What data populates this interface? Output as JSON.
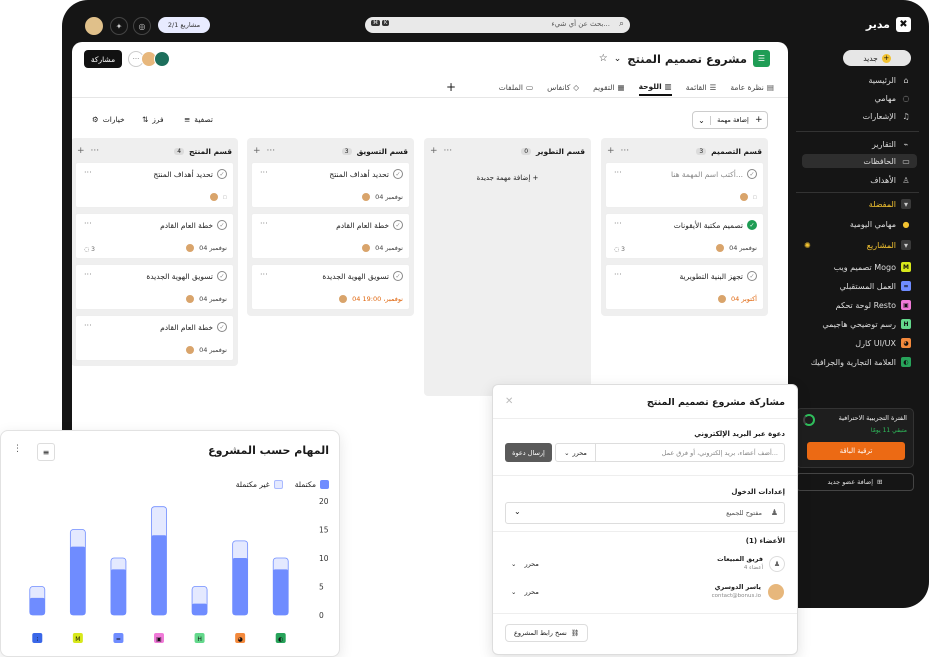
{
  "topbar": {
    "search_placeholder": "بحث عن أي شيء...",
    "kbd1": "⌘",
    "kbd2": "K",
    "projects_badge": "2/1 مشاريع"
  },
  "sidebar": {
    "app_name": "مدير",
    "new_label": "جديد",
    "nav": [
      {
        "label": "الرئيسية"
      },
      {
        "label": "مهامي"
      },
      {
        "label": "الإشعارات"
      }
    ],
    "nav2": [
      {
        "label": "التقارير"
      },
      {
        "label": "الحافظات"
      },
      {
        "label": "الأهداف"
      }
    ],
    "favorites_label": "المفضلة",
    "daily_tasks": "مهامي اليومية",
    "projects_label": "المشاريع",
    "projects": [
      {
        "label": "تصميم ويب Mogo",
        "letter": "M",
        "color": "#d7e81b"
      },
      {
        "label": "العمل المستقبلي",
        "letter": "=",
        "color": "#6f8cff"
      },
      {
        "label": "لوحة تحكم Resto",
        "letter": "▣",
        "color": "#f07ad8"
      },
      {
        "label": "رسم توضيحي هاجيمي",
        "letter": "H",
        "color": "#63d88b"
      },
      {
        "label": "كارل UI/UX",
        "letter": "◕",
        "color": "#f3893c"
      },
      {
        "label": "العلامة التجارية والجرافيك",
        "letter": "◐",
        "color": "#27a35a"
      }
    ],
    "trial_title": "الفترة التجريبية الاحترافية",
    "trial_remaining": "متبقي 11 يومًا",
    "upgrade_label": "ترقية الباقة",
    "add_member_label": "إضافة عضو جديد"
  },
  "header": {
    "project_title": "مشروع تصميم المنتج",
    "share_label": "مشاركة"
  },
  "tabs": [
    {
      "label": "نظرة عامة"
    },
    {
      "label": "القائمة"
    },
    {
      "label": "اللوحة"
    },
    {
      "label": "التقويم"
    },
    {
      "label": "كانفاس"
    },
    {
      "label": "الملفات"
    }
  ],
  "toolbar": {
    "add_task_label": "إضافة مهمة",
    "filter_label": "تصفية",
    "sort_label": "فرز",
    "options_label": "خيارات"
  },
  "columns": [
    {
      "title": "قسم التصميم",
      "count": "3",
      "cards": [
        {
          "title": "أكتب اسم المهمة هنا...",
          "date": "",
          "comments": ""
        },
        {
          "title": "تصميم مكتبة الأيقونات",
          "date": "04 نوفمبر",
          "comments": "3"
        },
        {
          "title": "تجهز البنية التطويرية",
          "date": "04 أكتوبر",
          "comments": ""
        }
      ]
    },
    {
      "title": "قسم التطوير",
      "count": "0",
      "add_label": "إضافة مهمة جديدة"
    },
    {
      "title": "قسم التسويق",
      "count": "3",
      "cards": [
        {
          "title": "تحديد أهداف المنتج",
          "date": "04 نوفمبر",
          "comments": ""
        },
        {
          "title": "خطة العام القادم",
          "date": "04 نوفمبر",
          "comments": ""
        },
        {
          "title": "تسويق الهوية الجديدة",
          "date": "04 نوفمبر، 19:00",
          "comments": ""
        }
      ]
    },
    {
      "title": "قسم المنتج",
      "count": "4",
      "cards": [
        {
          "title": "تحديد أهداف المنتج",
          "date": "",
          "comments": ""
        },
        {
          "title": "خطة العام القادم",
          "date": "04 نوفمبر",
          "comments": "3"
        },
        {
          "title": "تسويق الهوية الجديدة",
          "date": "04 نوفمبر",
          "comments": ""
        },
        {
          "title": "خطة العام القادم",
          "date": "04 نوفمبر",
          "comments": ""
        }
      ]
    }
  ],
  "share_panel": {
    "title": "مشاركة مشروع تصميم المنتج",
    "invite_label": "دعوة عبر البريد الإلكتروني",
    "invite_placeholder": "أضف أعضاء، بريد إلكتروني، أو فرق عمل...",
    "role_editor": "محرر",
    "send_label": "إرسال دعوة",
    "access_label": "إعدادات الدخول",
    "access_value": "مفتوح للجميع",
    "members_label": "الأعضاء (1)",
    "team_name": "فريق المبيعات",
    "team_sub": "4 أعضاء",
    "member_name": "ياسر الدوسري",
    "member_email": "contact@bonus.io",
    "copy_link": "نسخ رابط المشروع"
  },
  "chart_card": {
    "title": "المهام حسب المشروع",
    "legend_done": "مكتملة",
    "legend_undone": "غير مكتملة"
  },
  "chart_data": {
    "type": "bar",
    "title": "المهام حسب المشروع",
    "ylim": [
      0,
      20
    ],
    "yticks": [
      0,
      5,
      10,
      15,
      20
    ],
    "series": [
      {
        "name": "مكتملة",
        "values": [
          3,
          12,
          8,
          14,
          2,
          10,
          8,
          7
        ]
      },
      {
        "name": "غير مكتملة",
        "values": [
          2,
          3,
          2,
          5,
          3,
          3,
          2,
          3
        ]
      }
    ],
    "categories_icons": [
      {
        "letter": "◐",
        "color": "#27a35a"
      },
      {
        "letter": "◕",
        "color": "#f3893c"
      },
      {
        "letter": "H",
        "color": "#63d88b"
      },
      {
        "letter": "▣",
        "color": "#f07ad8"
      },
      {
        "letter": "=",
        "color": "#6f8cff"
      },
      {
        "letter": "M",
        "color": "#d7e81b"
      },
      {
        "letter": "⁝",
        "color": "#3a67e8"
      }
    ]
  }
}
